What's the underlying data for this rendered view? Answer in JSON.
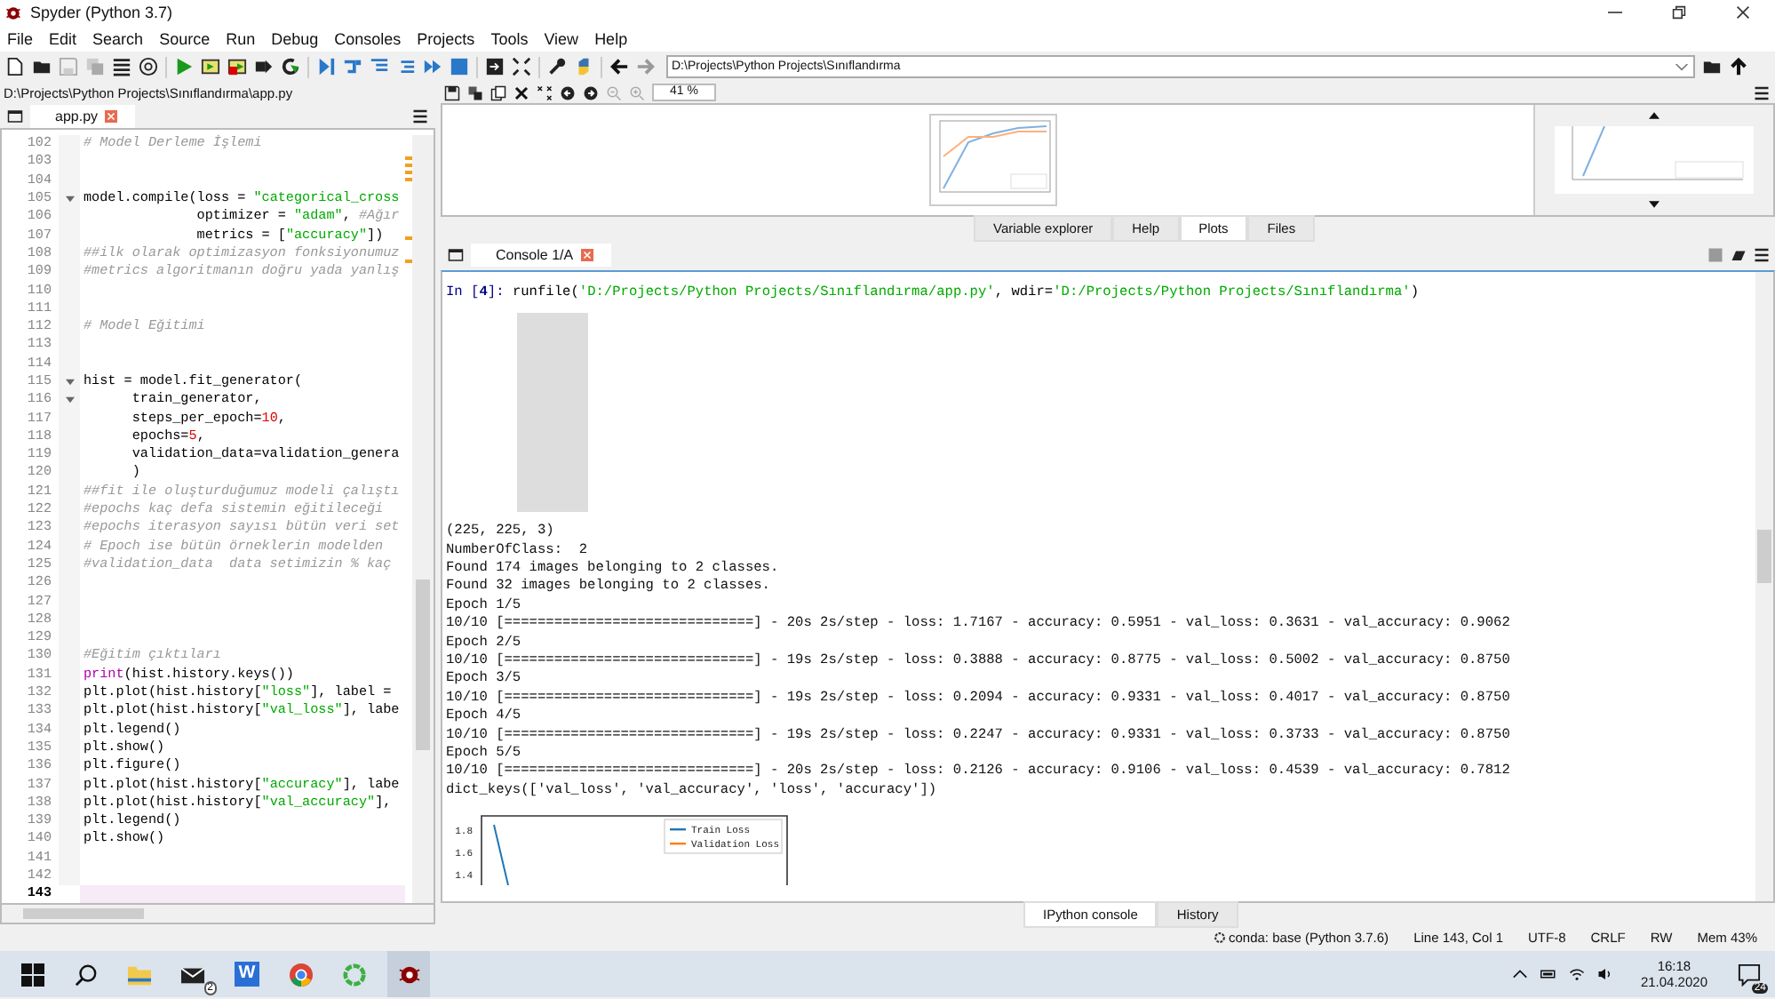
{
  "window": {
    "title": "Spyder (Python 3.7)"
  },
  "menu": [
    "File",
    "Edit",
    "Search",
    "Source",
    "Run",
    "Debug",
    "Consoles",
    "Projects",
    "Tools",
    "View",
    "Help"
  ],
  "toolbar": {
    "path": "D:\\Projects\\Python Projects\\Sınıflandırma"
  },
  "editor": {
    "path": "D:\\Projects\\Python Projects\\Sınıflandırma\\app.py",
    "tabs": [
      {
        "label": "app.py",
        "selected": true
      }
    ],
    "lines": [
      {
        "number": "102",
        "current": false,
        "foldable": false,
        "segs": [
          {
            "kind": "comment",
            "text": "# Model Derleme İşlemi"
          }
        ]
      },
      {
        "number": "103",
        "current": false,
        "foldable": false
      },
      {
        "number": "104",
        "current": false,
        "foldable": false
      },
      {
        "number": "105",
        "current": false,
        "foldable": true,
        "segs": [
          {
            "kind": "plain",
            "text": "model.compile(loss = "
          },
          {
            "kind": "string",
            "text": "\"categorical_cross"
          }
        ]
      },
      {
        "number": "106",
        "current": false,
        "foldable": false,
        "segs": [
          {
            "kind": "plain",
            "text": "              optimizer = "
          },
          {
            "kind": "string",
            "text": "\"adam\""
          },
          {
            "kind": "plain",
            "text": ", "
          },
          {
            "kind": "comment",
            "text": "#Ağır"
          }
        ]
      },
      {
        "number": "107",
        "current": false,
        "foldable": false,
        "segs": [
          {
            "kind": "plain",
            "text": "              metrics = ["
          },
          {
            "kind": "string",
            "text": "\"accuracy\""
          },
          {
            "kind": "plain",
            "text": "])"
          }
        ]
      },
      {
        "number": "108",
        "current": false,
        "foldable": false,
        "segs": [
          {
            "kind": "comment",
            "text": "##ilk olarak optimizasyon fonksiyonumuz"
          }
        ]
      },
      {
        "number": "109",
        "current": false,
        "foldable": false,
        "segs": [
          {
            "kind": "comment",
            "text": "#metrics algoritmanın doğru yada yanlış"
          }
        ]
      },
      {
        "number": "110",
        "current": false,
        "foldable": false
      },
      {
        "number": "111",
        "current": false,
        "foldable": false
      },
      {
        "number": "112",
        "current": false,
        "foldable": false,
        "segs": [
          {
            "kind": "comment",
            "text": "# Model Eğitimi"
          }
        ]
      },
      {
        "number": "113",
        "current": false,
        "foldable": false
      },
      {
        "number": "114",
        "current": false,
        "foldable": false
      },
      {
        "number": "115",
        "current": false,
        "foldable": true,
        "segs": [
          {
            "kind": "plain",
            "text": "hist = model.fit_generator("
          }
        ]
      },
      {
        "number": "116",
        "current": false,
        "foldable": true,
        "segs": [
          {
            "kind": "plain",
            "text": "      train_generator,"
          }
        ]
      },
      {
        "number": "117",
        "current": false,
        "foldable": false,
        "segs": [
          {
            "kind": "plain",
            "text": "      steps_per_epoch="
          },
          {
            "kind": "number",
            "text": "10"
          },
          {
            "kind": "plain",
            "text": ","
          }
        ]
      },
      {
        "number": "118",
        "current": false,
        "foldable": false,
        "segs": [
          {
            "kind": "plain",
            "text": "      epochs="
          },
          {
            "kind": "number",
            "text": "5"
          },
          {
            "kind": "plain",
            "text": ","
          }
        ]
      },
      {
        "number": "119",
        "current": false,
        "foldable": false,
        "segs": [
          {
            "kind": "plain",
            "text": "      validation_data=validation_genera"
          }
        ]
      },
      {
        "number": "120",
        "current": false,
        "foldable": false,
        "segs": [
          {
            "kind": "plain",
            "text": "      )"
          }
        ]
      },
      {
        "number": "121",
        "current": false,
        "foldable": false,
        "segs": [
          {
            "kind": "comment",
            "text": "##fit ile oluşturduğumuz modeli çalıştı"
          }
        ]
      },
      {
        "number": "122",
        "current": false,
        "foldable": false,
        "segs": [
          {
            "kind": "comment",
            "text": "#epochs kaç defa sistemin eğitileceği"
          }
        ]
      },
      {
        "number": "123",
        "current": false,
        "foldable": false,
        "segs": [
          {
            "kind": "comment",
            "text": "#epochs iterasyon sayısı bütün veri set"
          }
        ]
      },
      {
        "number": "124",
        "current": false,
        "foldable": false,
        "segs": [
          {
            "kind": "comment",
            "text": "# Epoch ise bütün örneklerin modelden"
          }
        ]
      },
      {
        "number": "125",
        "current": false,
        "foldable": false,
        "segs": [
          {
            "kind": "comment",
            "text": "#validation_data  data setimizin % kaç"
          }
        ]
      },
      {
        "number": "126",
        "current": false,
        "foldable": false
      },
      {
        "number": "127",
        "current": false,
        "foldable": false
      },
      {
        "number": "128",
        "current": false,
        "foldable": false
      },
      {
        "number": "129",
        "current": false,
        "foldable": false
      },
      {
        "number": "130",
        "current": false,
        "foldable": false,
        "segs": [
          {
            "kind": "comment",
            "text": "#Eğitim çıktıları"
          }
        ]
      },
      {
        "number": "131",
        "current": false,
        "foldable": false,
        "segs": [
          {
            "kind": "builtin",
            "text": "print"
          },
          {
            "kind": "plain",
            "text": "(hist.history.keys())"
          }
        ]
      },
      {
        "number": "132",
        "current": false,
        "foldable": false,
        "segs": [
          {
            "kind": "plain",
            "text": "plt.plot(hist.history["
          },
          {
            "kind": "string",
            "text": "\"loss\""
          },
          {
            "kind": "plain",
            "text": "], label ="
          }
        ]
      },
      {
        "number": "133",
        "current": false,
        "foldable": false,
        "segs": [
          {
            "kind": "plain",
            "text": "plt.plot(hist.history["
          },
          {
            "kind": "string",
            "text": "\"val_loss\""
          },
          {
            "kind": "plain",
            "text": "], labe"
          }
        ]
      },
      {
        "number": "134",
        "current": false,
        "foldable": false,
        "segs": [
          {
            "kind": "plain",
            "text": "plt.legend()"
          }
        ]
      },
      {
        "number": "135",
        "current": false,
        "foldable": false,
        "segs": [
          {
            "kind": "plain",
            "text": "plt.show()"
          }
        ]
      },
      {
        "number": "136",
        "current": false,
        "foldable": false,
        "segs": [
          {
            "kind": "plain",
            "text": "plt.figure()"
          }
        ]
      },
      {
        "number": "137",
        "current": false,
        "foldable": false,
        "segs": [
          {
            "kind": "plain",
            "text": "plt.plot(hist.history["
          },
          {
            "kind": "string",
            "text": "\"accuracy\""
          },
          {
            "kind": "plain",
            "text": "], labe"
          }
        ]
      },
      {
        "number": "138",
        "current": false,
        "foldable": false,
        "segs": [
          {
            "kind": "plain",
            "text": "plt.plot(hist.history["
          },
          {
            "kind": "string",
            "text": "\"val_accuracy\""
          },
          {
            "kind": "plain",
            "text": "],"
          }
        ]
      },
      {
        "number": "139",
        "current": false,
        "foldable": false,
        "segs": [
          {
            "kind": "plain",
            "text": "plt.legend()"
          }
        ]
      },
      {
        "number": "140",
        "current": false,
        "foldable": false,
        "segs": [
          {
            "kind": "plain",
            "text": "plt.show()"
          }
        ]
      },
      {
        "number": "141",
        "current": false,
        "foldable": false
      },
      {
        "number": "142",
        "current": false,
        "foldable": false
      },
      {
        "number": "143",
        "current": true,
        "foldable": false
      }
    ]
  },
  "plots": {
    "zoom": "41 %"
  },
  "pane_tabs": [
    {
      "label": "Variable explorer",
      "selected": false
    },
    {
      "label": "Help",
      "selected": false
    },
    {
      "label": "Plots",
      "selected": true
    },
    {
      "label": "Files",
      "selected": false
    }
  ],
  "console": {
    "tabs": [
      {
        "label": "Console 1/A",
        "selected": true
      }
    ],
    "output": [
      {
        "kind": "prompt",
        "prompt": "In [**4**]:",
        "segs": [
          {
            "kind": "plain",
            "text": "runfile("
          },
          {
            "kind": "string",
            "text": "'D:/Projects/Python Projects/Sınıflandırma/app.py'"
          },
          {
            "kind": "plain",
            "text": ", wdir="
          },
          {
            "kind": "string",
            "text": "'D:/Projects/Python Projects/Sınıflandırma'"
          },
          {
            "kind": "plain",
            "text": ")"
          }
        ]
      },
      {
        "kind": "image"
      },
      {
        "kind": "text",
        "text": "(225, 225, 3)"
      },
      {
        "kind": "text",
        "text": "NumberOfClass:  2"
      },
      {
        "kind": "text",
        "text": "Found 174 images belonging to 2 classes."
      },
      {
        "kind": "text",
        "text": "Found 32 images belonging to 2 classes."
      },
      {
        "kind": "text",
        "text": "Epoch 1/5"
      },
      {
        "kind": "text",
        "text": "10/10 [==============================] - 20s 2s/step - loss: 1.7167 - accuracy: 0.5951 - val_loss: 0.3631 - val_accuracy: 0.9062"
      },
      {
        "kind": "text",
        "text": "Epoch 2/5"
      },
      {
        "kind": "text",
        "text": "10/10 [==============================] - 19s 2s/step - loss: 0.3888 - accuracy: 0.8775 - val_loss: 0.5002 - val_accuracy: 0.8750"
      },
      {
        "kind": "text",
        "text": "Epoch 3/5"
      },
      {
        "kind": "text",
        "text": "10/10 [==============================] - 19s 2s/step - loss: 0.2094 - accuracy: 0.9331 - val_loss: 0.4017 - val_accuracy: 0.8750"
      },
      {
        "kind": "text",
        "text": "Epoch 4/5"
      },
      {
        "kind": "text",
        "text": "10/10 [==============================] - 19s 2s/step - loss: 0.2247 - accuracy: 0.9331 - val_loss: 0.3733 - val_accuracy: 0.8750"
      },
      {
        "kind": "text",
        "text": "Epoch 5/5"
      },
      {
        "kind": "text",
        "text": "10/10 [==============================] - 20s 2s/step - loss: 0.2126 - accuracy: 0.9106 - val_loss: 0.4539 - val_accuracy: 0.7812"
      },
      {
        "kind": "text",
        "text": "dict_keys(['val_loss', 'val_accuracy', 'loss', 'accuracy'])"
      },
      {
        "kind": "plot",
        "ytick_labels": [
          "1.8",
          "1.6",
          "1.4"
        ],
        "legend": [
          {
            "name": "Train Loss",
            "color": "#1f77b4"
          },
          {
            "name": "Validation Loss",
            "color": "#ff7f0e"
          }
        ]
      }
    ]
  },
  "bottom_tabs": [
    {
      "label": "IPython console",
      "selected": true
    },
    {
      "label": "History",
      "selected": false
    }
  ],
  "status_bar": [
    {
      "kind": "conda",
      "text": "conda: base (Python 3.7.6)"
    },
    {
      "kind": "plain",
      "text": "Line 143, Col 1"
    },
    {
      "kind": "plain",
      "text": "UTF-8"
    },
    {
      "kind": "plain",
      "text": "CRLF"
    },
    {
      "kind": "plain",
      "text": "RW"
    },
    {
      "kind": "plain",
      "text": "Mem 43%"
    }
  ],
  "taskbar": {
    "mail_badge": "2",
    "app_letter": "W",
    "time": "16:18",
    "date": "21.04.2020",
    "notifications": "24"
  }
}
